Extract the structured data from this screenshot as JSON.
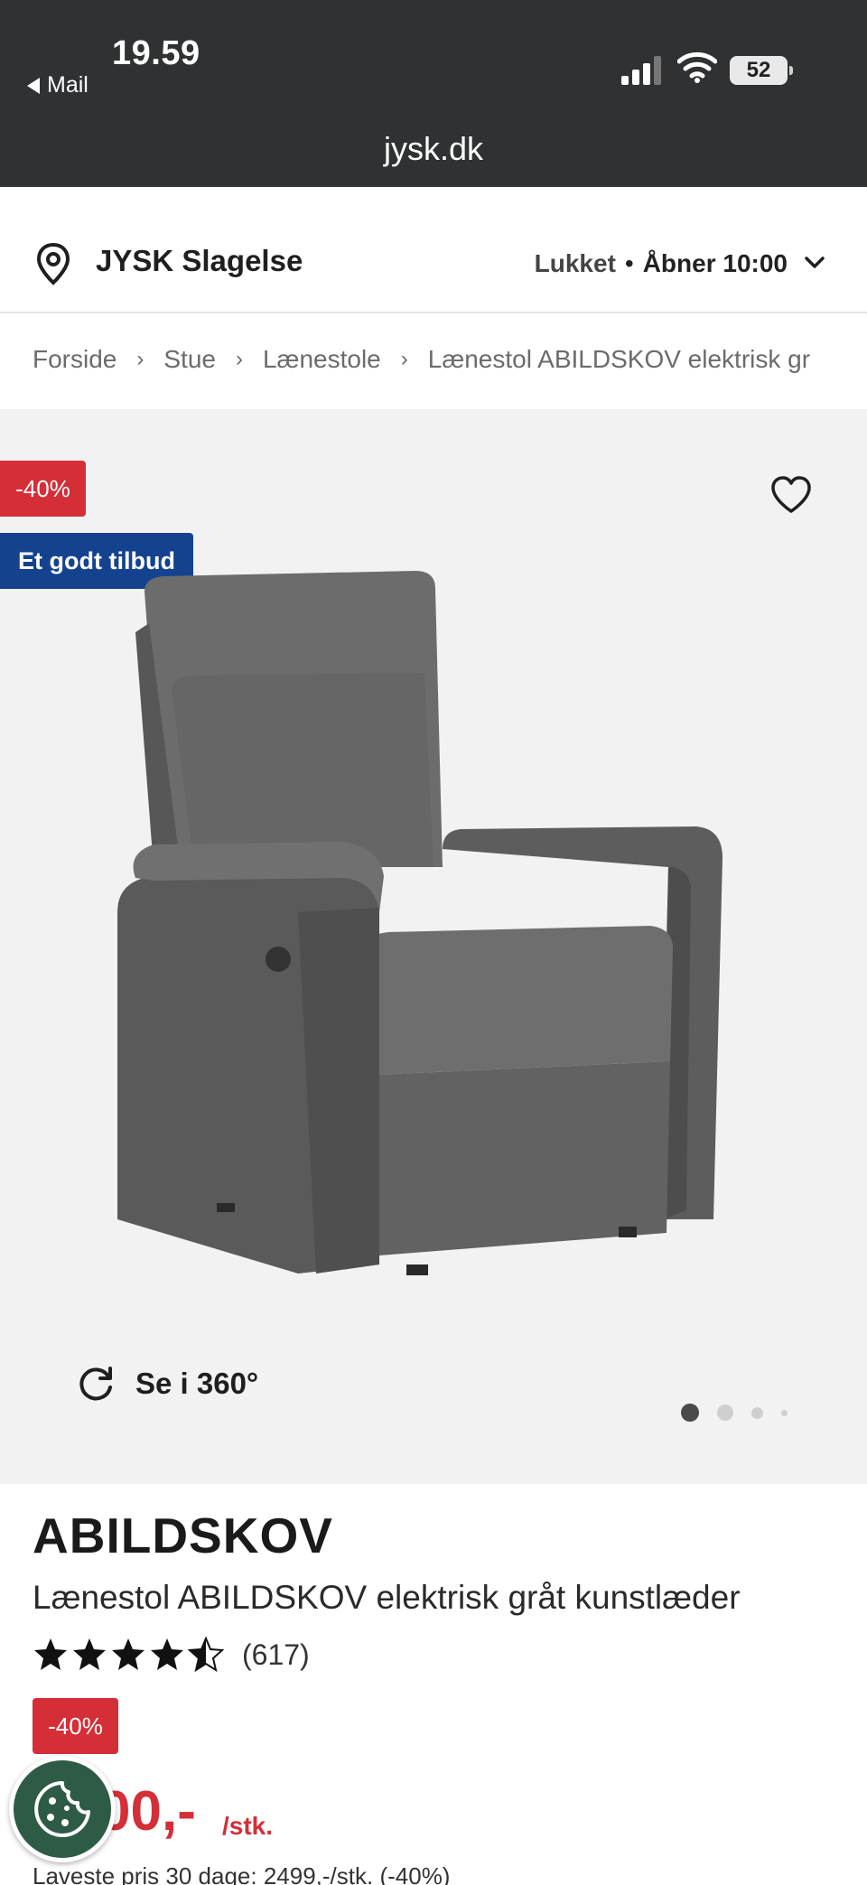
{
  "status_bar": {
    "time": "19.59",
    "back_app": "Mail",
    "battery": "52",
    "url": "jysk.dk"
  },
  "store": {
    "name": "JYSK Slagelse",
    "status": "Lukket",
    "separator": "•",
    "opens": "Åbner 10:00"
  },
  "breadcrumb": {
    "items": [
      "Forside",
      "Stue",
      "Lænestole",
      "Lænestol ABILDSKOV elektrisk gr"
    ],
    "separator": "›"
  },
  "gallery": {
    "discount_badge": "-40%",
    "offer_badge": "Et godt tilbud",
    "rotate_label": "Se i 360°",
    "image_count": 4,
    "active_index": 0
  },
  "product": {
    "brand": "ABILDSKOV",
    "title": "Lænestol ABILDSKOV elektrisk gråt kunstlæder",
    "rating": 4.5,
    "rating_count": "(617)",
    "price_badge": "-40%",
    "price_visible": "00,-",
    "unit": "/stk.",
    "lowest_price": "Laveste pris 30 dage: 2499,-/stk. (-40%)"
  },
  "colors": {
    "topbar": "#2f3132",
    "discount": "#d42e37",
    "offer": "#14428e",
    "cookie": "#2e5b46"
  }
}
